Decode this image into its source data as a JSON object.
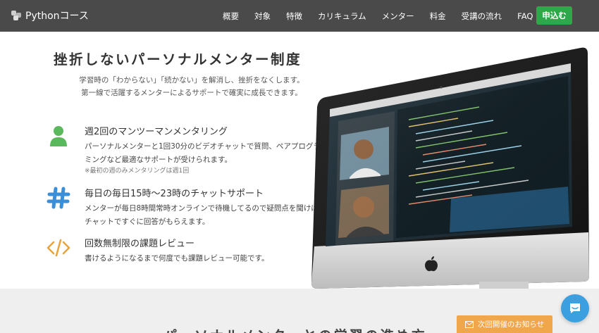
{
  "header": {
    "logo_text": "Pythonコース",
    "nav": [
      "概要",
      "対象",
      "特徴",
      "カリキュラム",
      "メンター",
      "料金",
      "受講の流れ",
      "FAQ"
    ],
    "apply_label": "申込む"
  },
  "hero": {
    "title": "挫折しないパーソナルメンター制度",
    "subtitle_line1": "学習時の「わからない」「続かない」を解消し、挫折をなくします。",
    "subtitle_line2": "第一線で活躍するメンターによるサポートで確実に成長できます。"
  },
  "features": [
    {
      "icon": "person-icon",
      "title": "週2回のマンツーマンメンタリング",
      "desc": "パーソナルメンターと1回30分のビデオチャットで質問、ペアプログラミングなど最適なサポートが受けられます。",
      "note": "※最初の週のみメンタリングは週1回"
    },
    {
      "icon": "hashtag-icon",
      "title": "毎日の毎日15時〜23時のチャットサポート",
      "desc": "メンターが毎日8時間常時オンラインで待機してるので疑問点を聞けばチャットですぐに回答がもらえます。"
    },
    {
      "icon": "code-icon",
      "title": "回数無制限の課題レビュー",
      "desc": "書けるようになるまで何度でも課題レビュー可能です。"
    }
  ],
  "bottom": {
    "section_title": "パーソナルメンターとの学習の進め方",
    "notice_label": "次回開催のお知らせ"
  },
  "colors": {
    "header_bg": "#4a4a4a",
    "apply_green": "#2ea84a",
    "person_green": "#5cb85c",
    "hashtag_blue": "#3b8fd9",
    "code_orange": "#e8a33d",
    "notice_orange": "#f0a64a",
    "chat_blue": "#3b9fe0"
  }
}
